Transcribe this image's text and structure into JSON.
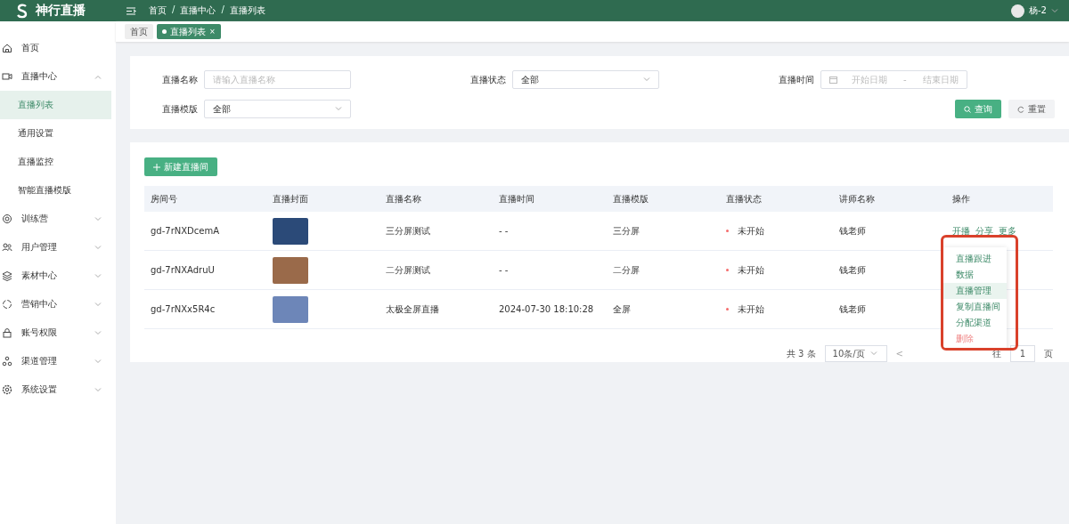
{
  "header": {
    "logo_text": "神行直播",
    "breadcrumb": [
      "首页",
      "直播中心",
      "直播列表"
    ],
    "breadcrumb_separator": "/",
    "user": "杨-2"
  },
  "tabs": [
    {
      "label": "首页",
      "selected": false
    },
    {
      "label": "直播列表",
      "selected": true,
      "close": "×"
    }
  ],
  "sidebar": {
    "items": [
      {
        "label": "首页",
        "selected": false
      },
      {
        "label": "直播中心",
        "expanded": true,
        "selected": false,
        "children": [
          {
            "label": "直播列表",
            "selected": true
          },
          {
            "label": "通用设置",
            "selected": false
          },
          {
            "label": "直播监控",
            "selected": false
          },
          {
            "label": "智能直播模版",
            "selected": false
          }
        ]
      },
      {
        "label": "训练营",
        "expanded": false,
        "selected": false
      },
      {
        "label": "用户管理",
        "expanded": false,
        "selected": false
      },
      {
        "label": "素材中心",
        "expanded": false,
        "selected": false
      },
      {
        "label": "营销中心",
        "expanded": false,
        "selected": false
      },
      {
        "label": "账号权限",
        "expanded": false,
        "selected": false
      },
      {
        "label": "渠道管理",
        "expanded": false,
        "selected": false
      },
      {
        "label": "系统设置",
        "expanded": false,
        "selected": false
      }
    ]
  },
  "filters": [
    {
      "kind": "text",
      "label": "直播名称",
      "placeholder": "请输入直播名称"
    },
    {
      "kind": "select",
      "label": "直播状态",
      "value": "全部"
    },
    {
      "kind": "daterange",
      "label": "直播时间",
      "start_placeholder": "开始日期",
      "separator": "-",
      "end_placeholder": "结束日期"
    },
    {
      "kind": "select",
      "label": "直播模版",
      "value": "全部"
    }
  ],
  "filter_buttons": [
    {
      "kind": "primary",
      "label": "查询"
    },
    {
      "kind": "default",
      "label": "重置"
    }
  ],
  "new_button": "新建直播间",
  "table": {
    "columns": [
      "房间号",
      "直播封面",
      "直播名称",
      "直播时间",
      "直播模版",
      "直播状态",
      "讲师名称",
      "操作"
    ],
    "rows": [
      {
        "room": "gd-7rNXDcemA",
        "name": "三分屏测试",
        "time": "- -",
        "template": "三分屏",
        "status": "未开始",
        "color": "#f56c6c",
        "lecturer": "钱老师",
        "actions": [
          "开播",
          "分享",
          "更多"
        ]
      },
      {
        "room": "gd-7rNXAdruU",
        "name": "二分屏测试",
        "time": "- -",
        "template": "二分屏",
        "status": "未开始",
        "color": "#f56c6c",
        "lecturer": "钱老师"
      },
      {
        "room": "gd-7rNXx5R4c",
        "name": "太极全屏直播",
        "time": "2024-07-30 18:10:28",
        "template": "全屏",
        "status": "未开始",
        "color": "#f56c6c",
        "lecturer": "钱老师"
      }
    ]
  },
  "more_menu": [
    {
      "label": "直播跟进",
      "kind": "normal",
      "highlighted": false
    },
    {
      "label": "数据",
      "kind": "normal",
      "highlighted": false
    },
    {
      "label": "直播管理",
      "kind": "normal",
      "highlighted": true
    },
    {
      "label": "复制直播间",
      "kind": "normal",
      "highlighted": false
    },
    {
      "label": "分配渠道",
      "kind": "normal",
      "highlighted": false
    },
    {
      "label": "删除",
      "kind": "danger",
      "highlighted": false
    }
  ],
  "pagination": {
    "total": "共 3 条",
    "page_size": "10条/页",
    "prev": "<",
    "goto_label": "往",
    "page": "1",
    "page_suffix": "页"
  }
}
